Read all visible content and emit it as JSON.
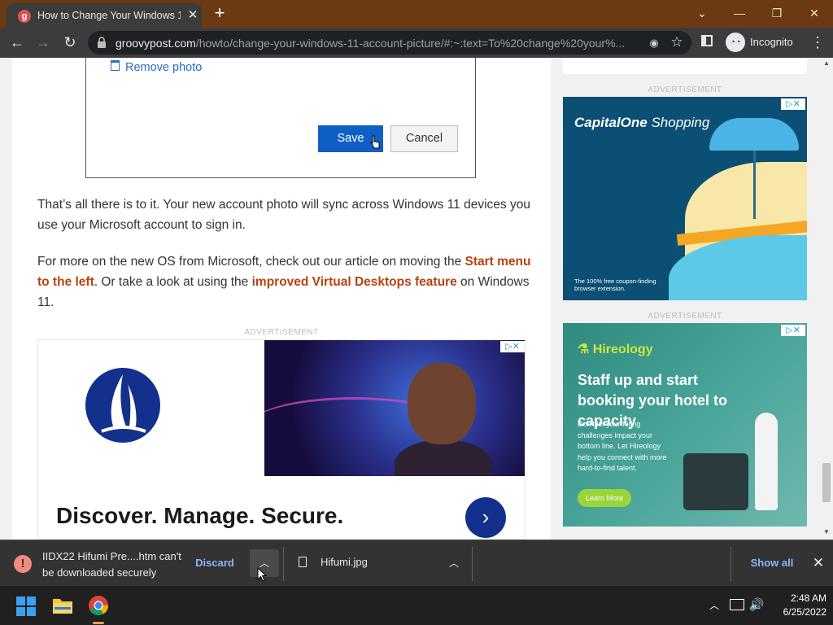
{
  "browser": {
    "tab_title": "How to Change Your Windows 1",
    "tab_favicon": "g",
    "new_tab_label": "+",
    "url_domain": "groovypost.com",
    "url_path": "/howto/change-your-windows-11-account-picture/#:~:text=To%20change%20your%...",
    "incognito_label": "Incognito",
    "window_controls": [
      "minimize-icon",
      "restore-icon",
      "close-icon"
    ]
  },
  "dialog": {
    "remove_photo_label": "Remove photo",
    "save_label": "Save",
    "cancel_label": "Cancel"
  },
  "article": {
    "para1": "That’s all there is to it. Your new account photo will sync across Windows 11 devices you use your Microsoft account to sign in.",
    "para2_part1": "For more on the new OS from Microsoft, check out our article on moving the ",
    "para2_link1": "Start menu to the left",
    "para2_part2": ". Or take a look at using the ",
    "para2_link2": "improved Virtual Desktops feature",
    "para2_part3": " on Windows 11.",
    "ad_label": "ADVERTISEMENT",
    "ad_headline": "Discover. Manage. Secure."
  },
  "sidebar": {
    "ad_label_1": "ADVERTISEMENT",
    "ad1_brand": "CapitalOne",
    "ad1_brand_suffix": " Shopping",
    "ad1_tagline": "The 100% free coupon-finding browser extension.",
    "ad_label_2": "ADVERTISEMENT",
    "ad2_brand": "Hireology",
    "ad2_headline": "Staff up and start booking your hotel to capacity",
    "ad2_body": "Don't let your hiring challenges impact your bottom line. Let Hireology help you connect with more hard-to-find talent.",
    "ad2_button": "Learn More"
  },
  "downloads": {
    "warning_text": "IIDX22 Hifumi Pre....htm can't be downloaded securely",
    "discard_label": "Discard",
    "file_name": "Hifumi.jpg",
    "show_all_label": "Show all"
  },
  "taskbar": {
    "time": "2:48 AM",
    "date": "6/25/2022"
  },
  "colors": {
    "titlebar": "#6b3a12",
    "link": "#b5430e",
    "save_button": "#0f5fc4",
    "download_link": "#8ab4f8"
  }
}
